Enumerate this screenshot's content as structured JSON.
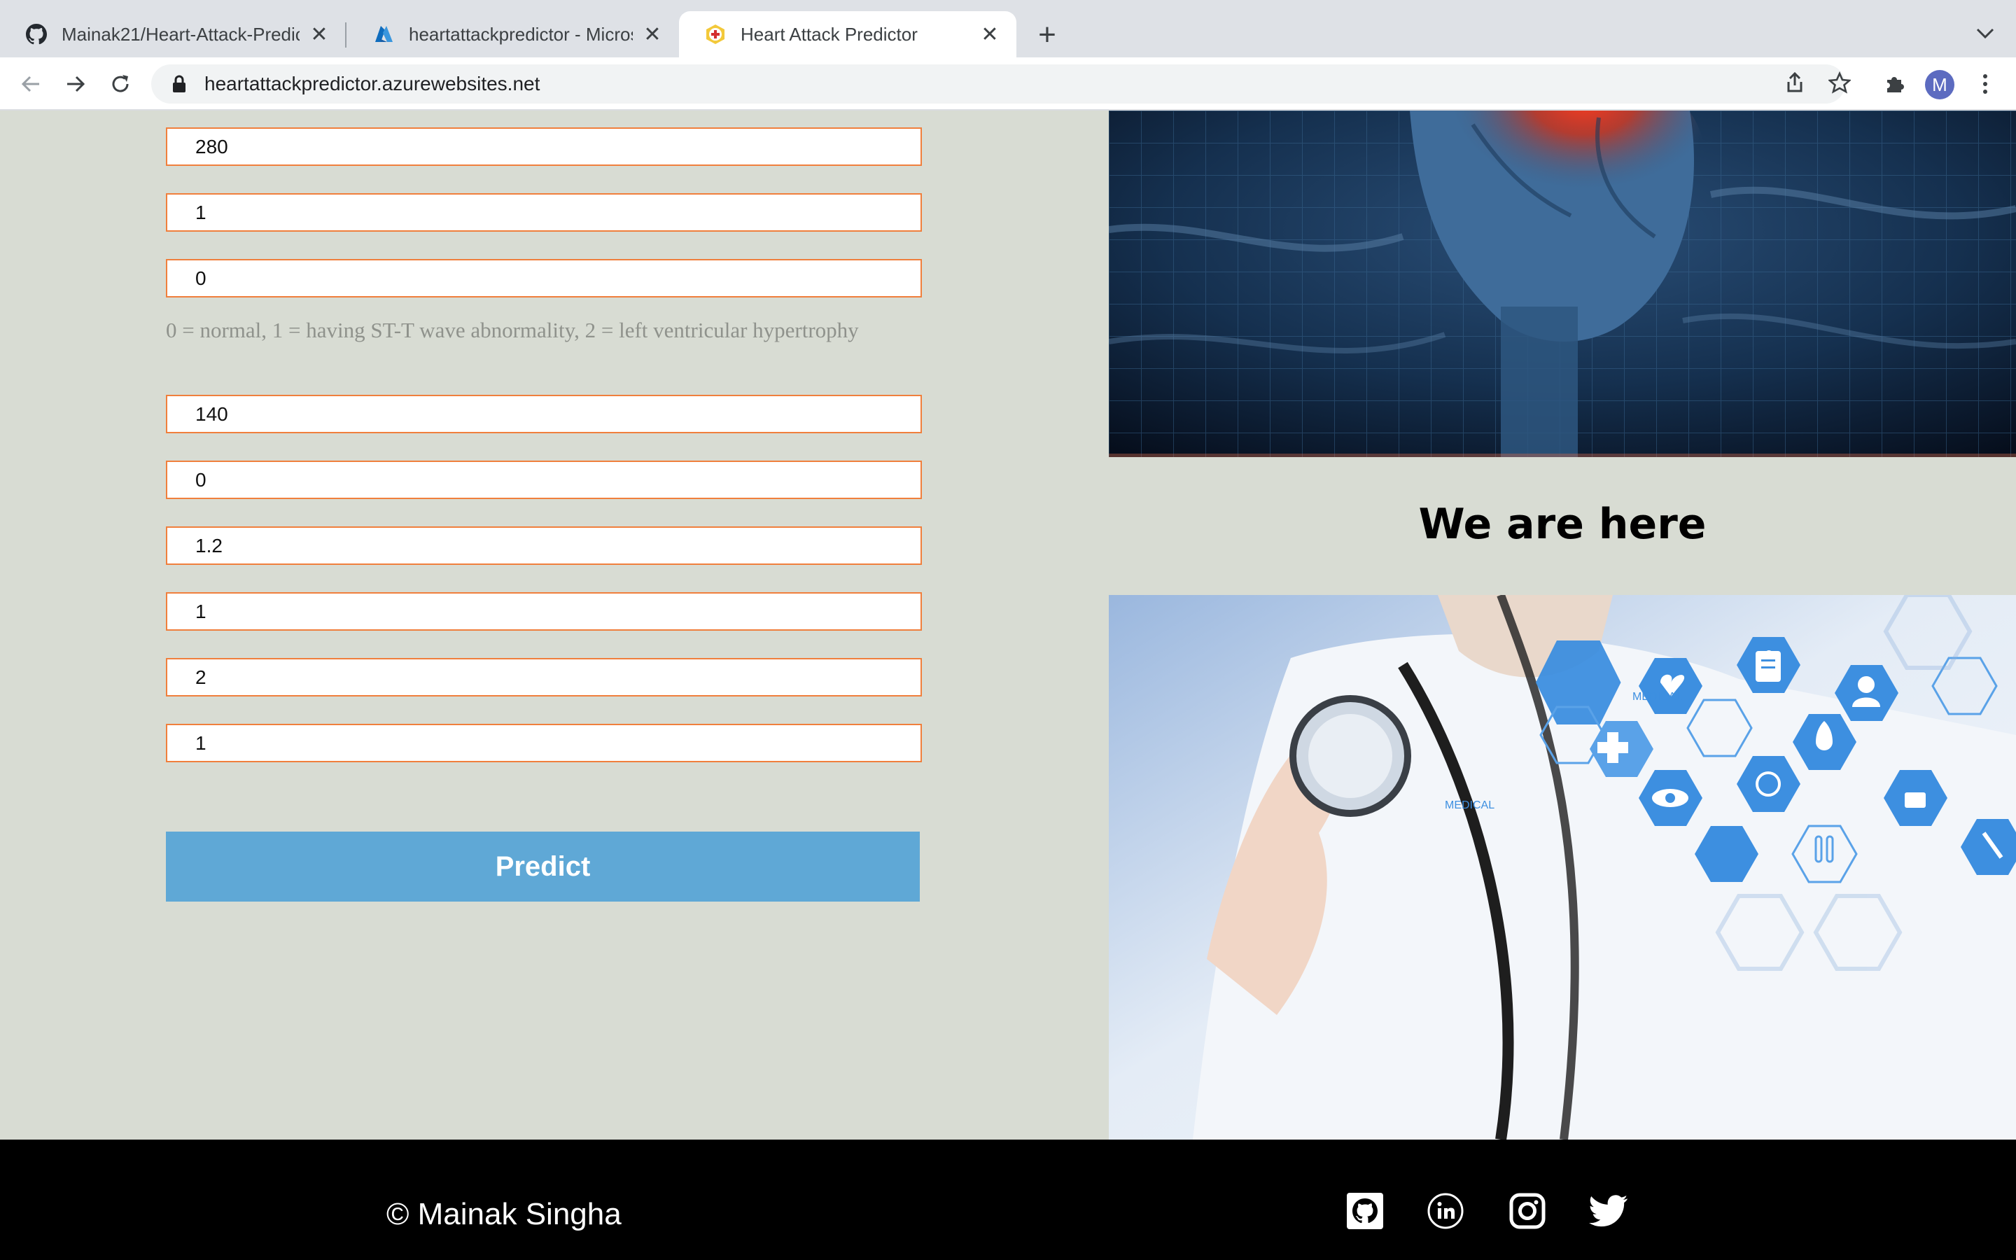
{
  "browser": {
    "tabs": [
      {
        "title": "Mainak21/Heart-Attack-Predict",
        "icon": "github-icon",
        "active": false
      },
      {
        "title": "heartattackpredictor - Microso",
        "icon": "azure-icon",
        "active": false
      },
      {
        "title": "Heart Attack Predictor",
        "icon": "heart-site-icon",
        "active": true
      }
    ],
    "url": "heartattackpredictor.azurewebsites.net",
    "profile_initial": "M"
  },
  "form": {
    "fields": [
      "280",
      "1",
      "0",
      "140",
      "0",
      "1.2",
      "1",
      "2",
      "1"
    ],
    "restecg_hint": "0 = normal, 1 = having ST-T wave abnormality, 2 = left ventricular hypertrophy",
    "predict_label": "Predict"
  },
  "side": {
    "heading": "We are here",
    "badge_medical_1": "MEDICAL",
    "badge_medical_2": "MEDICAL"
  },
  "footer": {
    "copyright": "© Mainak Singha",
    "social": [
      "github-icon",
      "linkedin-icon",
      "instagram-icon",
      "twitter-icon"
    ]
  },
  "colors": {
    "page_bg": "#d8dcd3",
    "field_border": "#f07f3c",
    "predict_bg": "#5fa8d6",
    "footer_bg": "#000000"
  }
}
